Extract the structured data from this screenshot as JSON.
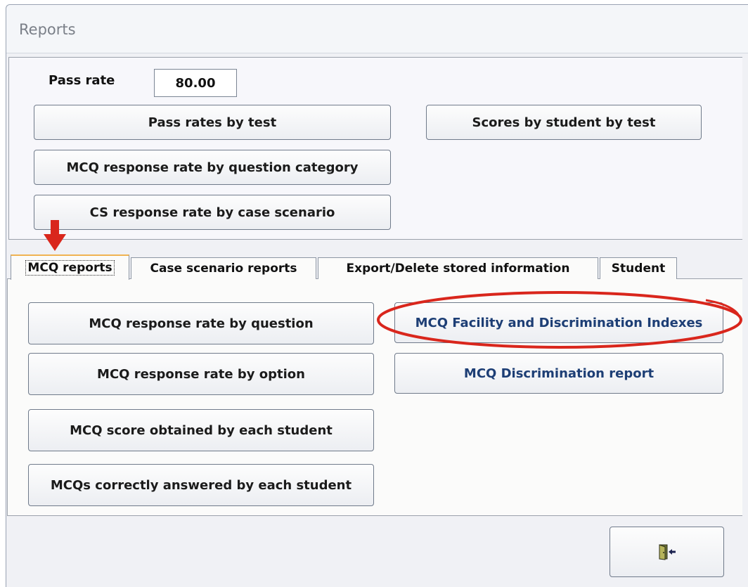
{
  "window": {
    "title": "Reports"
  },
  "pass_rate": {
    "label": "Pass rate",
    "value": "80.00"
  },
  "top_buttons": {
    "pass_rates_by_test": "Pass rates by test",
    "scores_by_student_by_test": "Scores by student by test",
    "mcq_response_rate_by_category": "MCQ response rate by question category",
    "cs_response_rate_by_case": "CS response rate by case scenario"
  },
  "tabs": [
    {
      "label": "MCQ reports",
      "active": true
    },
    {
      "label": "Case scenario reports",
      "active": false
    },
    {
      "label": "Export/Delete stored information",
      "active": false
    },
    {
      "label": "Student",
      "active": false
    }
  ],
  "mcq_tab": {
    "response_rate_by_question": "MCQ response rate by question",
    "facility_discrimination": "MCQ Facility and Discrimination Indexes",
    "response_rate_by_option": "MCQ response rate by option",
    "discrimination_report": "MCQ Discrimination report",
    "score_by_student": "MCQ score obtained by each student",
    "correctly_answered": "MCQs correctly answered by each student"
  },
  "footer": {
    "exit_icon": "exit-door-icon"
  },
  "colors": {
    "annotation_red": "#d9261c",
    "tab_highlight": "#f0b352",
    "button_text_blue": "#1d3e75"
  }
}
